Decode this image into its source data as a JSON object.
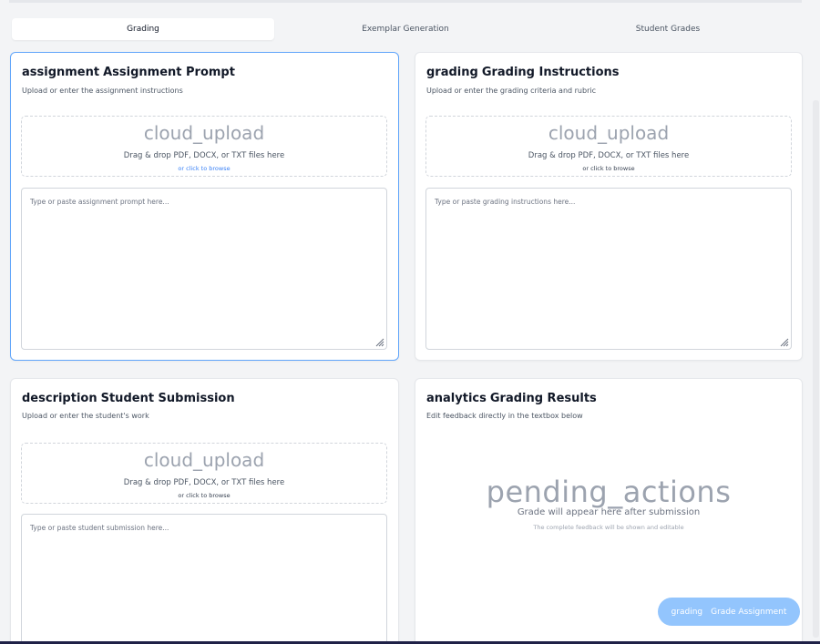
{
  "tabs": [
    {
      "label": "Grading",
      "active": true
    },
    {
      "label": "Exemplar Generation",
      "active": false
    },
    {
      "label": "Student Grades",
      "active": false
    }
  ],
  "assignment": {
    "icon": "assignment",
    "title": "Assignment Prompt",
    "subtitle": "Upload or enter the assignment instructions",
    "upload_icon": "cloud_upload",
    "drop_text": "Drag & drop PDF, DOCX, or TXT files here",
    "browse_text": "or click to browse",
    "placeholder": "Type or paste assignment prompt here..."
  },
  "grading_instructions": {
    "icon": "grading",
    "title": "Grading Instructions",
    "subtitle": "Upload or enter the grading criteria and rubric",
    "upload_icon": "cloud_upload",
    "drop_text": "Drag & drop PDF, DOCX, or TXT files here",
    "browse_text": "or click to browse",
    "placeholder": "Type or paste grading instructions here..."
  },
  "submission": {
    "icon": "description",
    "title": "Student Submission",
    "subtitle": "Upload or enter the student's work",
    "upload_icon": "cloud_upload",
    "drop_text": "Drag & drop PDF, DOCX, or TXT files here",
    "browse_text": "or click to browse",
    "placeholder": "Type or paste student submission here..."
  },
  "results": {
    "icon": "analytics",
    "title": "Grading Results",
    "subtitle": "Edit feedback directly in the textbox below",
    "pending_icon": "pending_actions",
    "message": "Grade will appear here after submission",
    "sub_message": "The complete feedback will be shown and editable"
  },
  "grade_button": {
    "icon": "grading",
    "label": "Grade Assignment"
  },
  "colors": {
    "focus_border": "#60a5fa",
    "button_bg": "#93c5fd",
    "browse_link": "#3b82f6"
  }
}
